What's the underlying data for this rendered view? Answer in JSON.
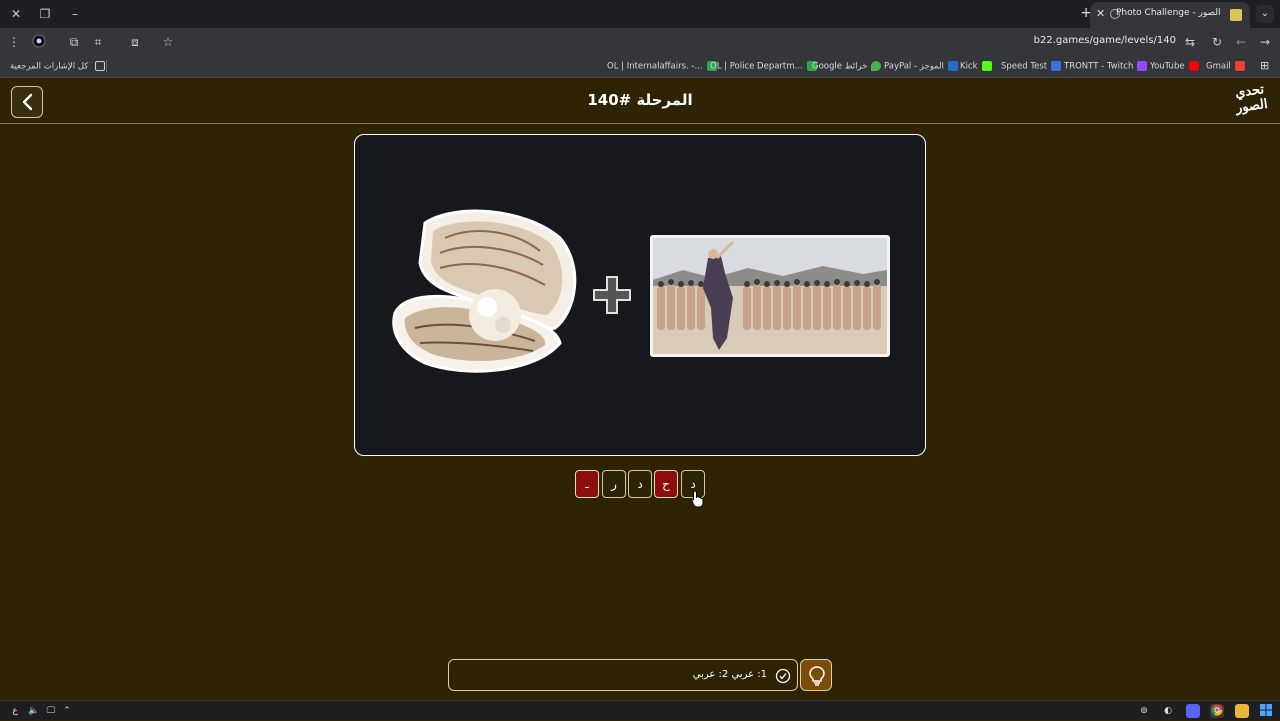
{
  "browser": {
    "tab_title": "Photo Challenge - تحدي الصور",
    "url": "b22.games/game/levels/140",
    "bookmarks_folder_label": "كل الإشارات المرجعية",
    "bookmarks": [
      {
        "label": "OL | Internalaffairs. -...",
        "color": "#2aa84a"
      },
      {
        "label": "OL | Police Departm...",
        "color": "#2aa84a"
      },
      {
        "label": "Google خرائط",
        "color": "#4caf50"
      },
      {
        "label": "PayPal - الموجز",
        "color": "#1f6fd1"
      },
      {
        "label": "Kick",
        "color": "#53fc18"
      },
      {
        "label": "Speed Test",
        "color": "#3b6fe0"
      },
      {
        "label": "TRONTT - Twitch",
        "color": "#9146ff"
      },
      {
        "label": "YouTube",
        "color": "#ff0000"
      },
      {
        "label": "Gmail",
        "color": "#ea4335"
      }
    ]
  },
  "header": {
    "level_title": "المرحلة #140",
    "logo_text_line1": "تحدي",
    "logo_text_line2": "الصور"
  },
  "puzzle": {
    "image1_icon": "pearl-oyster-image",
    "image2_icon": "folk-dance-group-image",
    "operator": "+"
  },
  "answer": {
    "slots": [
      {
        "char": "ـ",
        "revealed": true
      },
      {
        "char": "ر",
        "revealed": false
      },
      {
        "char": "د",
        "revealed": false
      },
      {
        "char": "ح",
        "revealed": true
      },
      {
        "char": "د",
        "revealed": false
      }
    ]
  },
  "hint": {
    "text": "1: عربي 2: عربي",
    "icon": "category-check-icon"
  },
  "colors": {
    "page_bg": "#2e2405",
    "card_bg": "#16181d",
    "revealed_slot": "#8e0d0d",
    "hint_button": "#7a4c08"
  }
}
